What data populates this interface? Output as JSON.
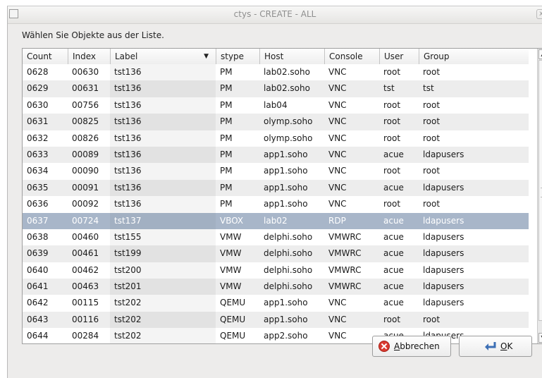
{
  "window": {
    "title": "ctys - CREATE - ALL",
    "close_glyph": "x"
  },
  "prompt": "Wählen Sie Objekte aus der Liste.",
  "columns": [
    "Count",
    "Index",
    "Label",
    "stype",
    "Host",
    "Console",
    "User",
    "Group"
  ],
  "sort_indicator": "▼",
  "rows": [
    [
      "0628",
      "00630",
      "tst136",
      "PM",
      "lab02.soho",
      "VNC",
      "root",
      "root"
    ],
    [
      "0629",
      "00631",
      "tst136",
      "PM",
      "lab02.soho",
      "VNC",
      "tst",
      "tst"
    ],
    [
      "0630",
      "00756",
      "tst136",
      "PM",
      "lab04",
      "VNC",
      "root",
      "root"
    ],
    [
      "0631",
      "00825",
      "tst136",
      "PM",
      "olymp.soho",
      "VNC",
      "root",
      "root"
    ],
    [
      "0632",
      "00826",
      "tst136",
      "PM",
      "olymp.soho",
      "VNC",
      "root",
      "root"
    ],
    [
      "0633",
      "00089",
      "tst136",
      "PM",
      "app1.soho",
      "VNC",
      "acue",
      "ldapusers"
    ],
    [
      "0634",
      "00090",
      "tst136",
      "PM",
      "app1.soho",
      "VNC",
      "root",
      "root"
    ],
    [
      "0635",
      "00091",
      "tst136",
      "PM",
      "app1.soho",
      "VNC",
      "acue",
      "ldapusers"
    ],
    [
      "0636",
      "00092",
      "tst136",
      "PM",
      "app1.soho",
      "VNC",
      "root",
      "root"
    ],
    [
      "0637",
      "00724",
      "tst137",
      "VBOX",
      "lab02",
      "RDP",
      "acue",
      "ldapusers"
    ],
    [
      "0638",
      "00460",
      "tst155",
      "VMW",
      "delphi.soho",
      "VMWRC",
      "acue",
      "ldapusers"
    ],
    [
      "0639",
      "00461",
      "tst199",
      "VMW",
      "delphi.soho",
      "VMWRC",
      "acue",
      "ldapusers"
    ],
    [
      "0640",
      "00462",
      "tst200",
      "VMW",
      "delphi.soho",
      "VMWRC",
      "acue",
      "ldapusers"
    ],
    [
      "0641",
      "00463",
      "tst201",
      "VMW",
      "delphi.soho",
      "VMWRC",
      "acue",
      "ldapusers"
    ],
    [
      "0642",
      "00115",
      "tst202",
      "QEMU",
      "app1.soho",
      "VNC",
      "acue",
      "ldapusers"
    ],
    [
      "0643",
      "00116",
      "tst202",
      "QEMU",
      "app1.soho",
      "VNC",
      "root",
      "root"
    ],
    [
      "0644",
      "00284",
      "tst202",
      "QEMU",
      "app2.soho",
      "VNC",
      "acue",
      "ldapusers"
    ]
  ],
  "selected_row_index": 9,
  "buttons": {
    "cancel_mnemonic": "A",
    "cancel_rest": "bbrechen",
    "ok_mnemonic": "O",
    "ok_rest": "K"
  },
  "scrollbar": {
    "up_glyph": "▲",
    "down_glyph": "▼"
  },
  "colors": {
    "selection": "#a8b6c9",
    "cancel_icon": "#d93a2f",
    "ok_icon": "#3c6fb5"
  }
}
